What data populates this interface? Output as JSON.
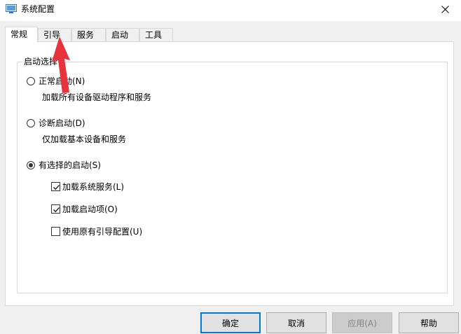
{
  "window": {
    "title": "系统配置",
    "close_icon": "close-icon",
    "app_icon": "msconfig-icon"
  },
  "tabs": [
    {
      "label": "常规",
      "active": true
    },
    {
      "label": "引导",
      "active": false
    },
    {
      "label": "服务",
      "active": false
    },
    {
      "label": "启动",
      "active": false
    },
    {
      "label": "工具",
      "active": false
    }
  ],
  "startup_group": {
    "title": "启动选择",
    "normal": {
      "label": "正常启动(N)",
      "desc": "加载所有设备驱动程序和服务",
      "selected": false
    },
    "diagnostic": {
      "label": "诊断启动(D)",
      "desc": "仅加载基本设备和服务",
      "selected": false
    },
    "selective": {
      "label": "有选择的启动(S)",
      "selected": true,
      "options": [
        {
          "label": "加载系统服务(L)",
          "checked": true
        },
        {
          "label": "加载启动项(O)",
          "checked": true
        },
        {
          "label": "使用原有引导配置(U)",
          "checked": false
        }
      ]
    }
  },
  "buttons": {
    "ok": "确定",
    "cancel": "取消",
    "apply": "应用(A)",
    "help": "帮助"
  },
  "annotation": {
    "arrow_color": "#e8323c"
  }
}
